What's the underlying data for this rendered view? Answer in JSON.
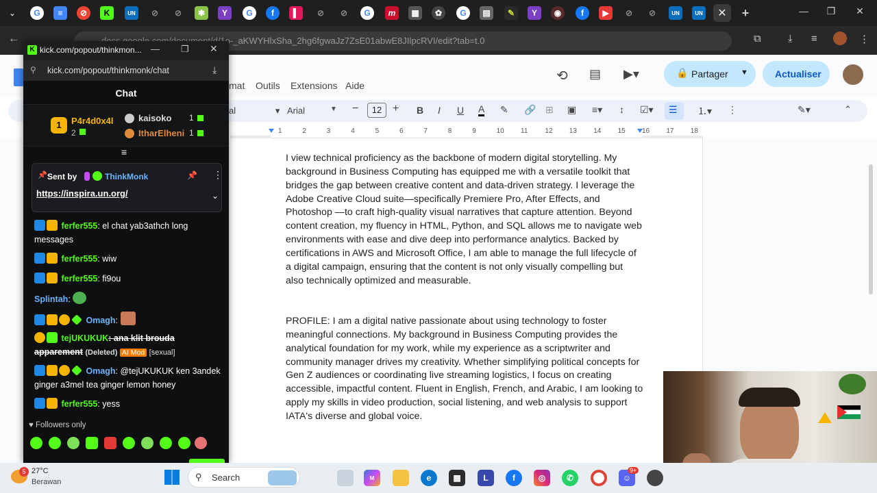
{
  "browser": {
    "url": "docs.google.com/document/d/1o-_aKWYHlxSha_2hg6fgwaJz7ZsE01abwE8JIlpcRVI/edit?tab=t.0"
  },
  "docs": {
    "menu": [
      "mat",
      "Outils",
      "Extensions",
      "Aide"
    ],
    "share_label": "Partager",
    "update_label": "Actualiser",
    "font_name": "Arial",
    "font_size": "12",
    "ruler_numbers": [
      "1",
      "2",
      "3",
      "4",
      "5",
      "6",
      "7",
      "8",
      "9",
      "10",
      "11",
      "12",
      "13",
      "14",
      "15",
      "16",
      "17",
      "18"
    ],
    "paragraph1": "I view technical proficiency as the backbone of modern digital storytelling. My background in Business Computing has equipped me with a versatile toolkit that bridges the gap between creative content and data-driven strategy. I leverage the Adobe Creative Cloud suite—specifically Premiere Pro, After Effects, and Photoshop —to craft high-quality visual narratives that capture attention. Beyond content creation, my fluency in HTML, Python, and SQL allows me to navigate web environments with ease and dive deep into performance analytics. Backed by certifications in AWS and Microsoft Office, I am able to manage the full lifecycle of a digital campaign, ensuring that the content is not only visually compelling but also technically optimized and measurable.",
    "paragraph2": "PROFILE: I am a digital native passionate about using technology to foster meaningful connections. My background in Business Computing provides the analytical foundation for my work, while my experience as a scriptwriter and community manager drives my creativity. Whether simplifying political concepts for Gen Z audiences or coordinating live streaming logistics, I focus on creating accessible, impactful content. Fluent in English, French, and Arabic, I am looking to apply my skills in video production, social listening, and web analysis to support IATA's diverse and global voice."
  },
  "kick": {
    "window_title": "kick.com/popout/thinkmon...",
    "url": "kick.com/popout/thinkmonk/chat",
    "chat_title": "Chat",
    "top_gifter": {
      "name": "P4r4d0x4l",
      "count": "2"
    },
    "leaders": [
      {
        "name": "kaisoko",
        "count": "1"
      },
      {
        "name": "ItharElheni",
        "count": "1"
      }
    ],
    "pinned": {
      "sent_by_label": "Sent by",
      "author": "ThinkMonk",
      "link": "https://inspira.un.org/"
    },
    "messages": [
      {
        "user": "ferfer555",
        "text": ": el chat yab3athch long messages"
      },
      {
        "user": "ferfer555",
        "text": ": wiw"
      },
      {
        "user": "ferfer555",
        "text": ": fi9ou"
      },
      {
        "user": "Splintah",
        "text": ":"
      },
      {
        "user": "Omagh",
        "text": ":"
      },
      {
        "user": "tejUKUKUK",
        "text": ": ana klit brouda apparement",
        "deleted_label": "(Deleted)",
        "mod_label": "AI Mod",
        "tag": "[sexual]"
      },
      {
        "user": "Omagh",
        "text": ": @tejUKUKUK ken 3andek ginger a3mel tea ginger lemon honey"
      },
      {
        "user": "ferfer555",
        "text": ": yess"
      }
    ],
    "followers_only": "Followers only"
  },
  "taskbar": {
    "temperature": "27°C",
    "weather": "Berawan",
    "weather_badge": "5",
    "search_label": "Search",
    "discord_badge": "9+"
  },
  "colors": {
    "kick_green": "#53fc18",
    "docs_blue": "#c2e7ff",
    "ferfer_color": "#53fc18",
    "omagh_color": "#6cb4ff"
  }
}
